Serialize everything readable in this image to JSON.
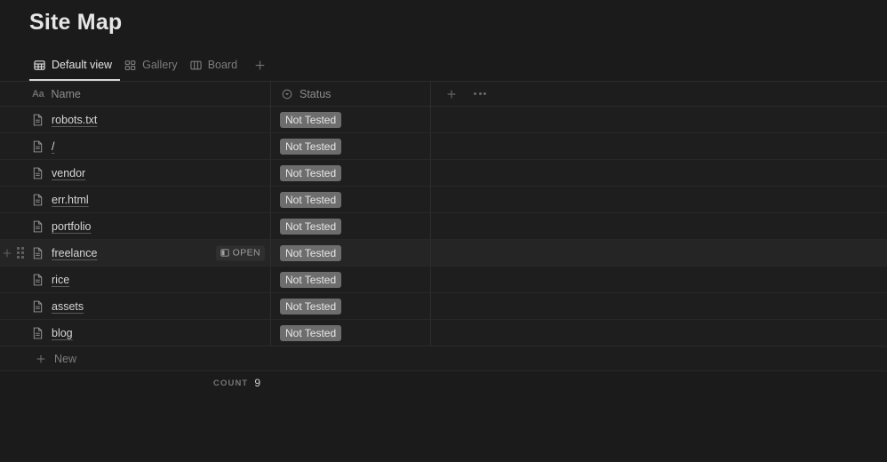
{
  "page": {
    "title": "Site Map"
  },
  "views": {
    "tabs": [
      {
        "label": "Default view",
        "icon": "table-icon",
        "active": true
      },
      {
        "label": "Gallery",
        "icon": "gallery-icon",
        "active": false
      },
      {
        "label": "Board",
        "icon": "board-icon",
        "active": false
      }
    ],
    "add_view_icon": "plus-icon"
  },
  "table": {
    "columns": [
      {
        "label": "Name",
        "icon": "text-type-icon",
        "type_glyph": "Aa"
      },
      {
        "label": "Status",
        "icon": "select-type-icon"
      }
    ],
    "header_actions": {
      "add_column_icon": "plus-icon",
      "more_options_icon": "ellipsis-icon"
    },
    "rows": [
      {
        "name": "robots.txt",
        "status": "Not Tested",
        "hover": false
      },
      {
        "name": "/",
        "status": "Not Tested",
        "hover": false
      },
      {
        "name": "vendor",
        "status": "Not Tested",
        "hover": false
      },
      {
        "name": "err.html",
        "status": "Not Tested",
        "hover": false
      },
      {
        "name": "portfolio",
        "status": "Not Tested",
        "hover": false
      },
      {
        "name": "freelance",
        "status": "Not Tested",
        "hover": true,
        "open_label": "OPEN"
      },
      {
        "name": "rice",
        "status": "Not Tested",
        "hover": false
      },
      {
        "name": "assets",
        "status": "Not Tested",
        "hover": false
      },
      {
        "name": "blog",
        "status": "Not Tested",
        "hover": false
      }
    ],
    "new_row": {
      "label": "New",
      "icon": "plus-icon"
    },
    "footer": {
      "count_label": "COUNT",
      "count_value": "9"
    }
  },
  "colors": {
    "page_background": "#1b1b1b",
    "row_background": "#1e1e1e",
    "row_hover_background": "#252525",
    "row_divider": "#282828",
    "badge_background": "#6d6d6d",
    "badge_text": "#e8e8e8",
    "title_text": "#e6e6e6",
    "active_tab_text": "#e3e3e3",
    "inactive_tab_text": "#7d7d7d"
  }
}
